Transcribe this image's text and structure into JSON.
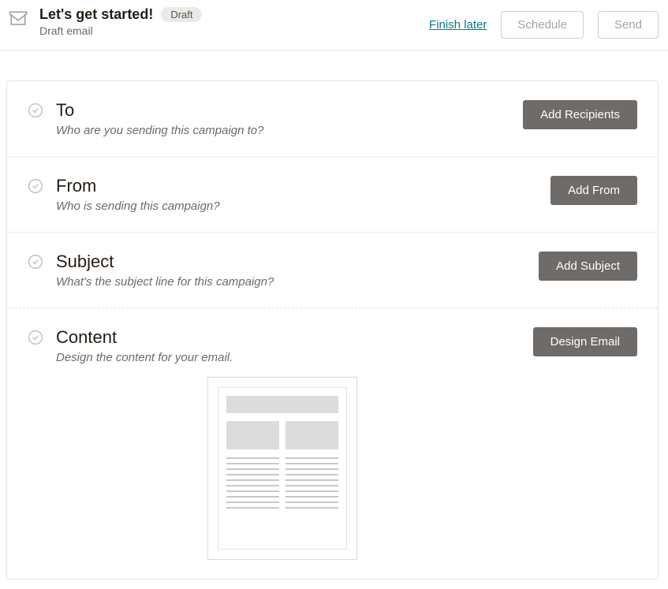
{
  "header": {
    "title": "Let's get started!",
    "badge": "Draft",
    "subtitle": "Draft email",
    "finish_later": "Finish later",
    "schedule": "Schedule",
    "send": "Send"
  },
  "sections": {
    "to": {
      "title": "To",
      "desc": "Who are you sending this campaign to?",
      "button": "Add Recipients"
    },
    "from": {
      "title": "From",
      "desc": "Who is sending this campaign?",
      "button": "Add From"
    },
    "subject": {
      "title": "Subject",
      "desc": "What's the subject line for this campaign?",
      "button": "Add Subject"
    },
    "content": {
      "title": "Content",
      "desc": "Design the content for your email.",
      "button": "Design Email"
    }
  }
}
